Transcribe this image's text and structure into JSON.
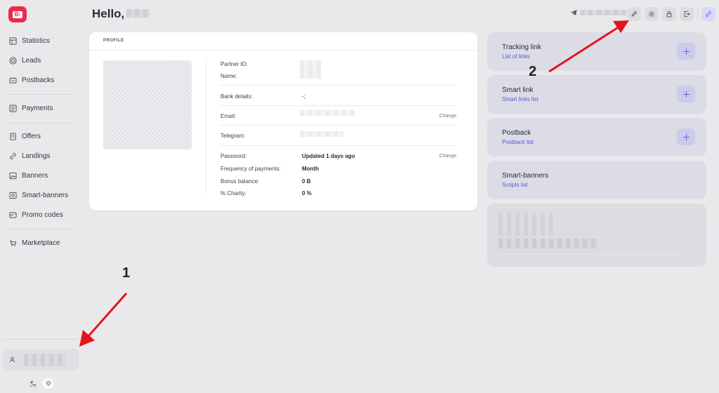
{
  "header": {
    "greeting": "Hello,"
  },
  "sidebar": {
    "items": [
      {
        "label": "Statistics",
        "icon": "table-icon"
      },
      {
        "label": "Leads",
        "icon": "target-icon"
      },
      {
        "label": "Postbacks",
        "icon": "postback-icon"
      },
      {
        "label": "Payments",
        "icon": "payments-icon"
      },
      {
        "label": "Offers",
        "icon": "offers-icon"
      },
      {
        "label": "Landings",
        "icon": "link-icon"
      },
      {
        "label": "Banners",
        "icon": "image-icon"
      },
      {
        "label": "Smart-banners",
        "icon": "smart-banner-icon"
      },
      {
        "label": "Promo codes",
        "icon": "promo-icon"
      },
      {
        "label": "Marketplace",
        "icon": "cart-icon"
      }
    ]
  },
  "profile": {
    "title": "PROFILE",
    "fields": {
      "partner_id": "Partner ID:",
      "name": "Name:",
      "bank_details": "Bank details:",
      "bank_details_value": "-;",
      "email": "Email:",
      "email_action": "Change",
      "telegram": "Telegram:",
      "password": "Password:",
      "password_value": "Updated 1 days ago",
      "password_action": "Change",
      "frequency": "Frequency of payments:",
      "frequency_value": "Month",
      "bonus": "Bonus balance:",
      "bonus_value": "0 B",
      "charity": "% Charity:",
      "charity_value": "0 %"
    }
  },
  "right_cards": [
    {
      "title": "Tracking link",
      "link": "List of links",
      "has_plus": true
    },
    {
      "title": "Smart link",
      "link": "Smart links list",
      "has_plus": true
    },
    {
      "title": "Postback",
      "link": "Postback list",
      "has_plus": true
    },
    {
      "title": "Smart-banners",
      "link": "Scripts list",
      "has_plus": false
    }
  ],
  "annotations": {
    "one": "1",
    "two": "2"
  },
  "colors": {
    "brand": "#ef2a4a",
    "accent_link": "#5a55d9",
    "arrow": "#e5131c"
  }
}
